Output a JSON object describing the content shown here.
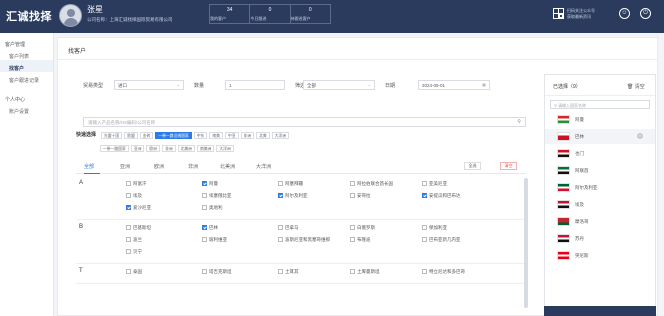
{
  "header": {
    "logo": "汇诚找择",
    "user_name": "张星",
    "company": "公司名称：上海汇诚找择国际贸易有限公司",
    "stats": [
      {
        "num": "34",
        "label": "我的客户"
      },
      {
        "num": "0",
        "label": "今日跟进"
      },
      {
        "num": "0",
        "label": "待跟进客户"
      }
    ],
    "qr_text": [
      "扫码关注公众号",
      "获取最新资讯"
    ]
  },
  "sidebar": {
    "groups": [
      {
        "title": "客户管理",
        "items": [
          {
            "label": "客户列表",
            "active": false
          },
          {
            "label": "找客户",
            "active": true
          },
          {
            "label": "客户跟进记录",
            "active": false
          }
        ]
      },
      {
        "title": "个人中心",
        "items": [
          {
            "label": "账户设置",
            "active": false
          }
        ]
      }
    ]
  },
  "main": {
    "title": "找客户",
    "filters": {
      "trade_type_label": "贸易类型",
      "trade_type_value": "进口",
      "quantity_label": "数量",
      "quantity_value": "1",
      "filter_label": "筛选",
      "filter_value": "全部",
      "date_label": "日期",
      "date_value": "2024-05-01"
    },
    "search_placeholder": "请输入产品名称/HS编码/公司名称",
    "tag_rows": [
      {
        "tags": [
          {
            "label": "快速选择",
            "on": false,
            "first": true
          },
          {
            "label": "东盟十国",
            "on": false
          },
          {
            "label": "欧盟",
            "on": false
          },
          {
            "label": "金砖",
            "on": false
          },
          {
            "label": "一带一路沿线国家",
            "on": true
          },
          {
            "label": "中东",
            "on": false
          },
          {
            "label": "南美",
            "on": false
          },
          {
            "label": "中亚",
            "on": false
          },
          {
            "label": "非洲",
            "on": false
          },
          {
            "label": "北美",
            "on": false
          },
          {
            "label": "大洋洲",
            "on": false
          }
        ]
      },
      {
        "tags": [
          {
            "label": "一带一路国家",
            "on": false
          },
          {
            "label": "亚洲",
            "on": false
          },
          {
            "label": "欧洲",
            "on": false
          },
          {
            "label": "非洲",
            "on": false
          },
          {
            "label": "北美洲",
            "on": false
          },
          {
            "label": "南美洲",
            "on": false
          },
          {
            "label": "大洋洲",
            "on": false
          }
        ]
      }
    ],
    "tabs": [
      "全部",
      "亚洲",
      "欧洲",
      "非洲",
      "北美洲",
      "大洋洲"
    ],
    "buttons": {
      "select_all": "全选",
      "clear": "清空"
    },
    "groups": [
      {
        "letter": "A",
        "items": [
          {
            "label": "阿富汗",
            "checked": false
          },
          {
            "label": "阿曼",
            "checked": true
          },
          {
            "label": "阿塞拜疆",
            "checked": false
          },
          {
            "label": "阿拉伯联合酋长国",
            "checked": false
          },
          {
            "label": "亚美尼亚",
            "checked": false
          },
          {
            "label": "埃及",
            "checked": false
          },
          {
            "label": "埃塞俄比亚",
            "checked": false
          },
          {
            "label": "阿尔及利亚",
            "checked": true
          },
          {
            "label": "安哥拉",
            "checked": false
          },
          {
            "label": "安提瓜和巴布达",
            "checked": true
          },
          {
            "label": "爱沙尼亚",
            "checked": true
          },
          {
            "label": "奥地利",
            "checked": false
          }
        ]
      },
      {
        "letter": "B",
        "items": [
          {
            "label": "巴基斯坦",
            "checked": false
          },
          {
            "label": "巴林",
            "checked": true
          },
          {
            "label": "巴拿马",
            "checked": false
          },
          {
            "label": "白俄罗斯",
            "checked": false
          },
          {
            "label": "保加利亚",
            "checked": false
          },
          {
            "label": "波兰",
            "checked": false
          },
          {
            "label": "玻利维亚",
            "checked": false
          },
          {
            "label": "波斯尼亚和黑塞哥维那",
            "checked": false
          },
          {
            "label": "布隆迪",
            "checked": false
          },
          {
            "label": "巴布亚新几内亚",
            "checked": false
          },
          {
            "label": "贝宁",
            "checked": false
          }
        ]
      },
      {
        "letter": "T",
        "items": [
          {
            "label": "泰国",
            "checked": false
          },
          {
            "label": "塔吉克斯坦",
            "checked": false
          },
          {
            "label": "土耳其",
            "checked": false
          },
          {
            "label": "土库曼斯坦",
            "checked": false
          },
          {
            "label": "特立尼达和多巴哥",
            "checked": false
          }
        ]
      }
    ]
  },
  "selected_panel": {
    "title": "已选择（9）",
    "clear": "清空",
    "search_placeholder": "请输入国家名称",
    "countries": [
      {
        "name": "阿曼",
        "colors": [
          "#d62828",
          "#ffffff",
          "#2d8a3e"
        ]
      },
      {
        "name": "巴林",
        "colors": [
          "#ffffff",
          "#ce1126",
          "#ce1126"
        ],
        "highlight": true
      },
      {
        "name": "也门",
        "colors": [
          "#ce1126",
          "#ffffff",
          "#111111"
        ]
      },
      {
        "name": "阿联酋",
        "colors": [
          "#00732f",
          "#ffffff",
          "#111111"
        ]
      },
      {
        "name": "阿尔及利亚",
        "colors": [
          "#006233",
          "#ffffff",
          "#d21034"
        ]
      },
      {
        "name": "埃及",
        "colors": [
          "#ce1126",
          "#ffffff",
          "#111111"
        ]
      },
      {
        "name": "摩洛哥",
        "colors": [
          "#c1272d",
          "#c1272d",
          "#006233"
        ]
      },
      {
        "name": "苏丹",
        "colors": [
          "#d21034",
          "#ffffff",
          "#111111"
        ]
      },
      {
        "name": "突尼斯",
        "colors": [
          "#e70013",
          "#ffffff",
          "#e70013"
        ]
      }
    ]
  }
}
